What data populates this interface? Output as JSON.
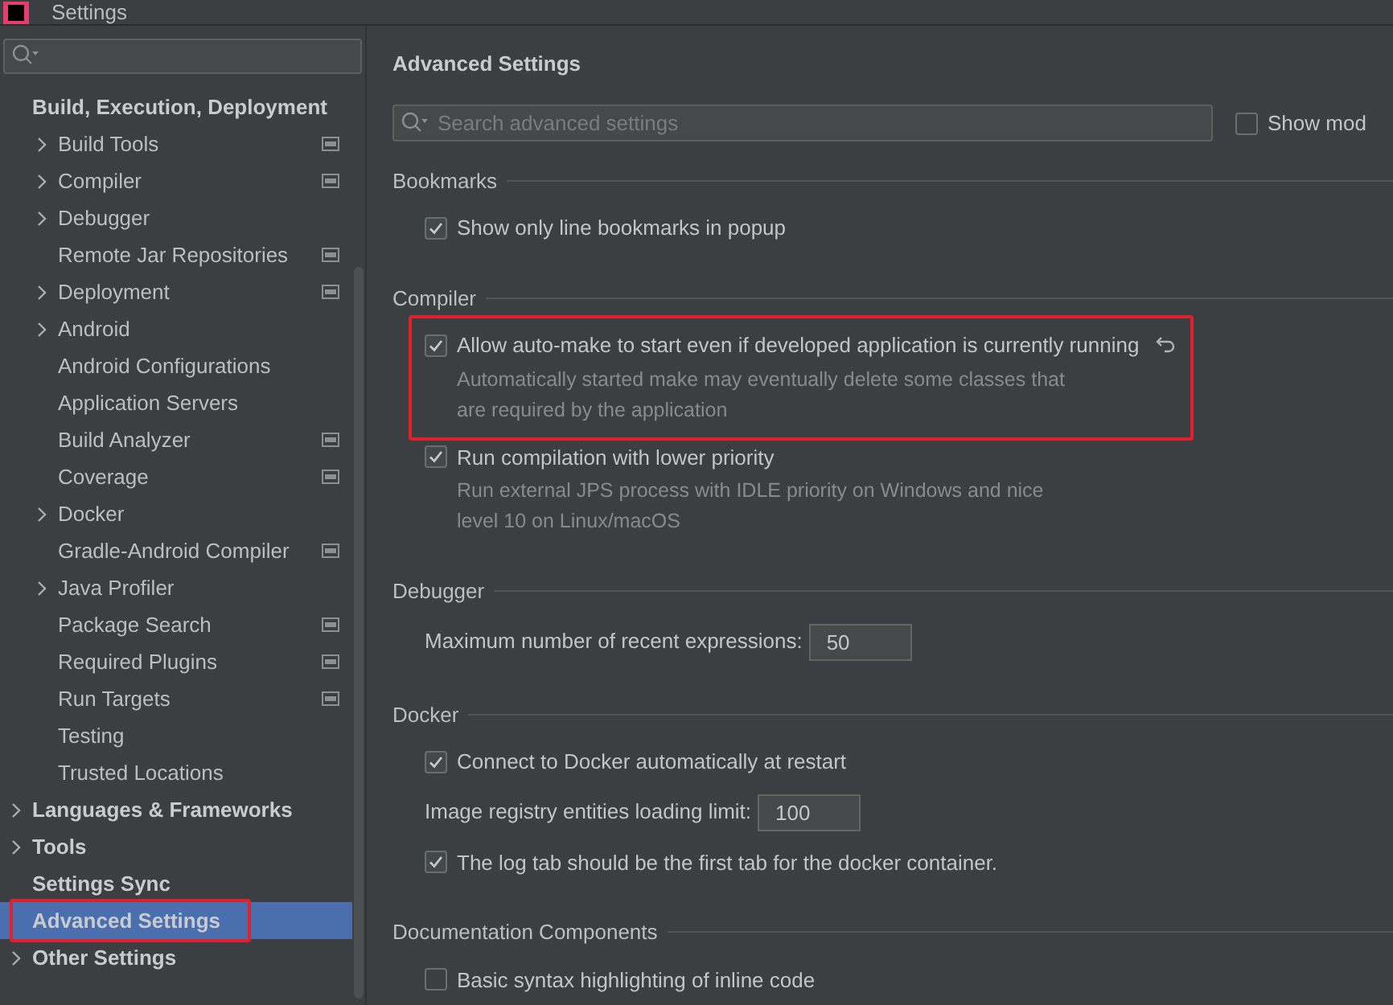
{
  "window": {
    "title": "Settings"
  },
  "sidebar": {
    "items": [
      {
        "label": "Build, Execution, Deployment",
        "expandable": false,
        "selected": false,
        "highlighted": false,
        "children": [
          {
            "label": "Build Tools",
            "expandable": true,
            "project_icon": true
          },
          {
            "label": "Compiler",
            "expandable": true,
            "project_icon": true
          },
          {
            "label": "Debugger",
            "expandable": true,
            "project_icon": false
          },
          {
            "label": "Remote Jar Repositories",
            "expandable": false,
            "project_icon": true
          },
          {
            "label": "Deployment",
            "expandable": true,
            "project_icon": true
          },
          {
            "label": "Android",
            "expandable": true,
            "project_icon": false
          },
          {
            "label": "Android Configurations",
            "expandable": false,
            "project_icon": false
          },
          {
            "label": "Application Servers",
            "expandable": false,
            "project_icon": false
          },
          {
            "label": "Build Analyzer",
            "expandable": false,
            "project_icon": true
          },
          {
            "label": "Coverage",
            "expandable": false,
            "project_icon": true
          },
          {
            "label": "Docker",
            "expandable": true,
            "project_icon": false
          },
          {
            "label": "Gradle-Android Compiler",
            "expandable": false,
            "project_icon": true
          },
          {
            "label": "Java Profiler",
            "expandable": true,
            "project_icon": false
          },
          {
            "label": "Package Search",
            "expandable": false,
            "project_icon": true
          },
          {
            "label": "Required Plugins",
            "expandable": false,
            "project_icon": true
          },
          {
            "label": "Run Targets",
            "expandable": false,
            "project_icon": true
          },
          {
            "label": "Testing",
            "expandable": false,
            "project_icon": false
          },
          {
            "label": "Trusted Locations",
            "expandable": false,
            "project_icon": false
          }
        ]
      },
      {
        "label": "Languages & Frameworks",
        "expandable": true,
        "selected": false,
        "highlighted": false
      },
      {
        "label": "Tools",
        "expandable": true,
        "selected": false,
        "highlighted": false
      },
      {
        "label": "Settings Sync",
        "expandable": false,
        "selected": false,
        "highlighted": false
      },
      {
        "label": "Advanced Settings",
        "expandable": false,
        "selected": true,
        "highlighted": true
      },
      {
        "label": "Other Settings",
        "expandable": true,
        "selected": false,
        "highlighted": false
      }
    ]
  },
  "main": {
    "title": "Advanced Settings",
    "search": {
      "placeholder": "Search advanced settings"
    },
    "show_modified": {
      "label": "Show mod",
      "checked": false
    },
    "sections": [
      {
        "title": "Bookmarks",
        "rows": [
          {
            "kind": "checkbox",
            "label": "Show only line bookmarks in popup",
            "checked": true,
            "highlighted": false,
            "reset": false
          }
        ]
      },
      {
        "title": "Compiler",
        "rows": [
          {
            "kind": "checkbox",
            "label": "Allow auto-make to start even if developed application is currently running",
            "checked": true,
            "highlighted": true,
            "reset": true,
            "description": [
              "Automatically started make may eventually delete some classes that",
              "are required by the application"
            ]
          },
          {
            "kind": "checkbox",
            "label": "Run compilation with lower priority",
            "checked": true,
            "highlighted": false,
            "reset": false,
            "description": [
              "Run external JPS process with IDLE priority on Windows and nice",
              "level 10 on Linux/macOS"
            ]
          }
        ]
      },
      {
        "title": "Debugger",
        "rows": [
          {
            "kind": "number",
            "label": "Maximum number of recent expressions:",
            "value": "50"
          }
        ]
      },
      {
        "title": "Docker",
        "rows": [
          {
            "kind": "checkbox",
            "label": "Connect to Docker automatically at restart",
            "checked": true,
            "highlighted": false,
            "reset": false
          },
          {
            "kind": "number",
            "label": "Image registry entities loading limit:",
            "value": "100"
          },
          {
            "kind": "checkbox",
            "label": "The log tab should be the first tab for the docker container.",
            "checked": true,
            "highlighted": false,
            "reset": false
          }
        ]
      },
      {
        "title": "Documentation Components",
        "rows": [
          {
            "kind": "checkbox",
            "label": "Basic syntax highlighting of inline code",
            "checked": false,
            "highlighted": false,
            "reset": false
          }
        ]
      }
    ]
  }
}
